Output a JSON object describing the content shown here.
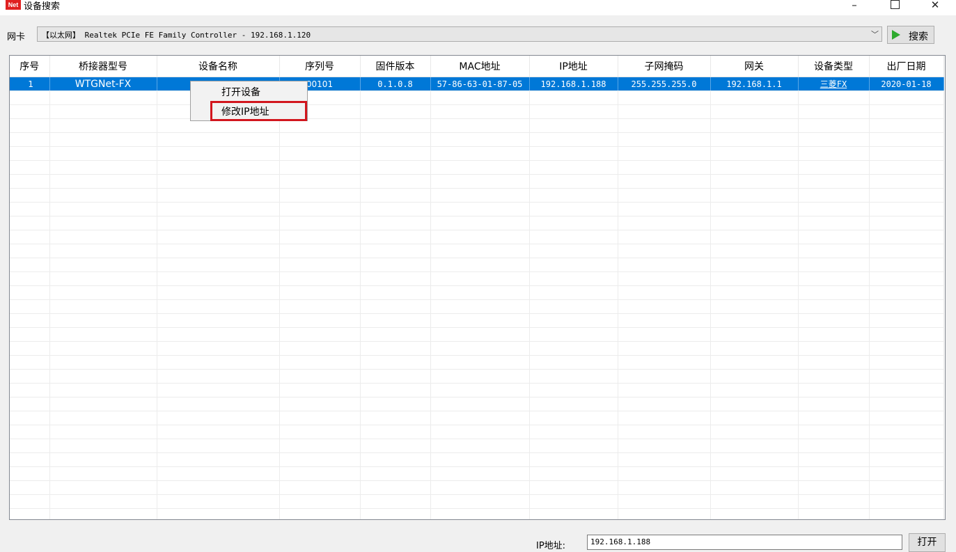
{
  "window": {
    "app_icon_text": "Net",
    "title": "设备搜索",
    "minimize_glyph": "–",
    "close_glyph": "✕"
  },
  "nic": {
    "label": "网卡",
    "selected": "【以太网】 Realtek PCIe FE Family Controller - 192.168.1.120",
    "dropdown_glyph": "﹀"
  },
  "search_button": {
    "label": "搜索",
    "icon": "play-icon",
    "icon_color": "#2eaa2e"
  },
  "table": {
    "columns": [
      "序号",
      "桥接器型号",
      "设备名称",
      "序列号",
      "固件版本",
      "MAC地址",
      "IP地址",
      "子网掩码",
      "网关",
      "设备类型",
      "出厂日期"
    ],
    "rows": [
      [
        "1",
        "WTGNet-FX",
        "",
        "00101",
        "0.1.0.8",
        "57-86-63-01-87-05",
        "192.168.1.188",
        "255.255.255.0",
        "192.168.1.1",
        "三菱FX",
        "2020-01-18"
      ]
    ],
    "selected_row_color": "#0078d7"
  },
  "context_menu": {
    "items": [
      "打开设备",
      "修改IP地址"
    ],
    "highlight_color": "#d2161e"
  },
  "footer": {
    "ip_label": "IP地址:",
    "ip_value": "192.168.1.188",
    "open_label": "打开"
  }
}
